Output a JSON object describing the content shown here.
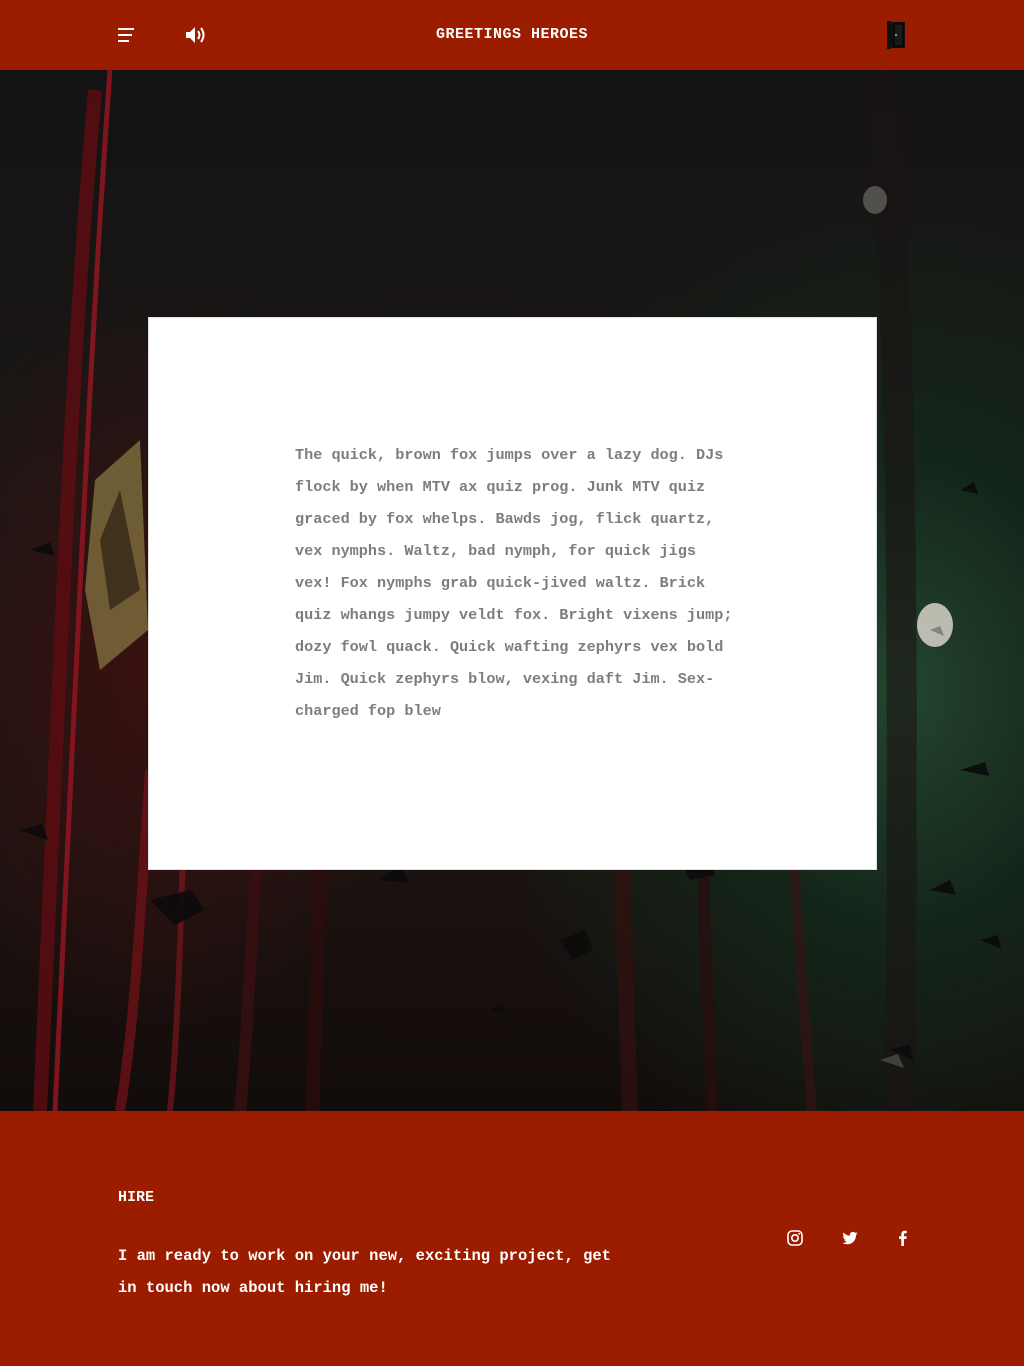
{
  "header": {
    "title": "GREETINGS HEROES",
    "menu_icon": "hamburger-menu-icon",
    "sound_icon": "speaker-volume-icon",
    "exit_icon": "door-icon"
  },
  "hero": {
    "card_text": "The quick, brown fox jumps over a lazy dog. DJs flock by when MTV ax quiz prog. Junk MTV quiz graced by fox whelps. Bawds jog, flick quartz, vex nymphs. Waltz, bad nymph, for quick jigs vex! Fox nymphs grab quick-jived waltz. Brick quiz whangs jumpy veldt fox. Bright vixens jump; dozy fowl quack. Quick wafting zephyrs vex bold Jim. Quick zephyrs blow, vexing daft Jim. Sex-charged fop blew"
  },
  "footer": {
    "hire_title": "HIRE",
    "hire_text": "I am ready to work on your new, exciting project, get in touch now about hiring me!",
    "social": [
      "instagram-icon",
      "twitter-icon",
      "facebook-icon"
    ]
  },
  "colors": {
    "brand_red": "#9c1c00",
    "card_background": "#ffffff",
    "card_text": "#7d7d7d"
  }
}
